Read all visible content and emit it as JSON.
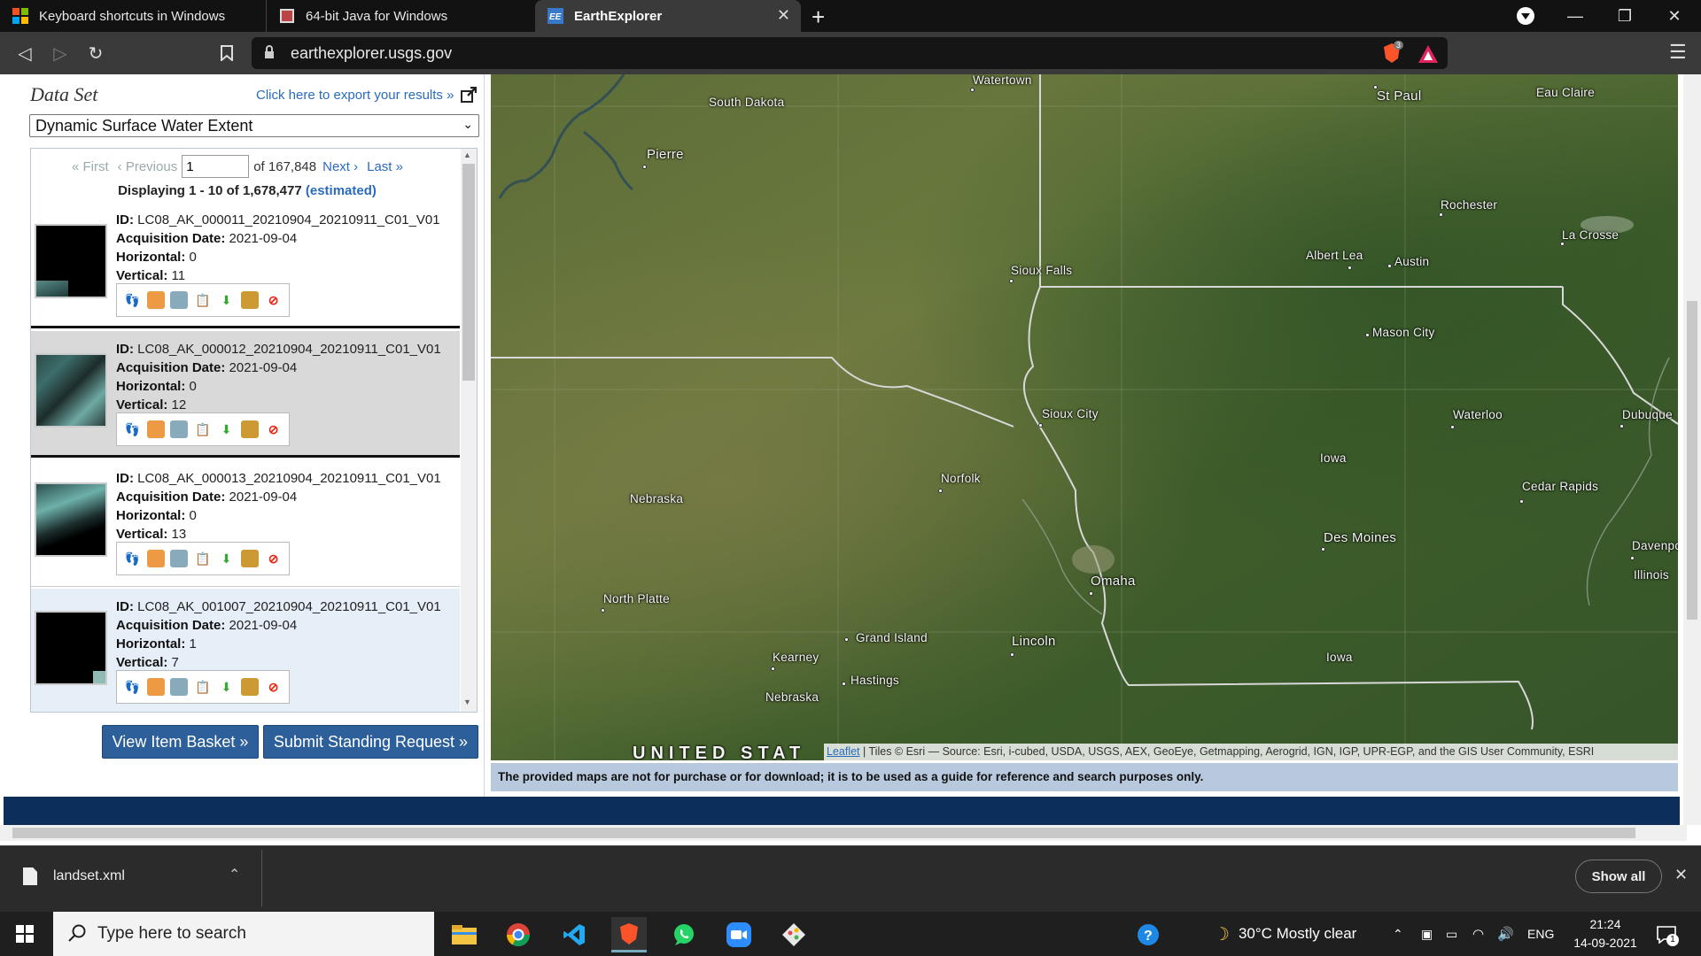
{
  "browser": {
    "tabs": [
      {
        "title": "Keyboard shortcuts in Windows",
        "active": false
      },
      {
        "title": "64-bit Java for Windows",
        "active": false
      },
      {
        "title": "EarthExplorer",
        "active": true
      }
    ],
    "url": "earthexplorer.usgs.gov",
    "shield_count": "3"
  },
  "sidebar": {
    "dataset_heading": "Data Set",
    "export_link": "Click here to export your results »",
    "dataset_selected": "Dynamic Surface Water Extent",
    "pager": {
      "first": "« First",
      "previous": "‹ Previous",
      "page_value": "1",
      "of_pages": "of 167,848",
      "next": "Next ›",
      "last": "Last »"
    },
    "displaying": "Displaying 1 - 10 of 1,678,477",
    "estimated": "(estimated)",
    "labels": {
      "id": "ID:",
      "acq": "Acquisition Date:",
      "horiz": "Horizontal:",
      "vert": "Vertical:"
    },
    "results": [
      {
        "id": "LC08_AK_000011_20210904_20210911_C01_V01",
        "acq_date": "2021-09-04",
        "horizontal": "0",
        "vertical": "11"
      },
      {
        "id": "LC08_AK_000012_20210904_20210911_C01_V01",
        "acq_date": "2021-09-04",
        "horizontal": "0",
        "vertical": "12"
      },
      {
        "id": "LC08_AK_000013_20210904_20210911_C01_V01",
        "acq_date": "2021-09-04",
        "horizontal": "0",
        "vertical": "13"
      },
      {
        "id": "LC08_AK_001007_20210904_20210911_C01_V01",
        "acq_date": "2021-09-04",
        "horizontal": "1",
        "vertical": "7"
      }
    ],
    "view_basket": "View Item Basket »",
    "standing_request": "Submit Standing Request »"
  },
  "map": {
    "labels": {
      "south_dakota": "South Dakota",
      "pierre": "Pierre",
      "watertown": "Watertown",
      "st_paul": "St Paul",
      "eau_claire": "Eau Claire",
      "rochester": "Rochester",
      "la_crosse": "La Crosse",
      "albert_lea": "Albert Lea",
      "austin": "Austin",
      "sioux_falls": "Sioux Falls",
      "mason_city": "Mason City",
      "sioux_city": "Sioux City",
      "waterloo": "Waterloo",
      "dubuque": "Dubuque",
      "iowa1": "Iowa",
      "norfolk": "Norfolk",
      "nebraska1": "Nebraska",
      "cedar_rapids": "Cedar Rapids",
      "des_moines": "Des Moines",
      "davenport": "Davenpo",
      "illinois": "Illinois",
      "omaha": "Omaha",
      "north_platte": "North Platte",
      "grand_island": "Grand Island",
      "lincoln": "Lincoln",
      "kearney": "Kearney",
      "hastings": "Hastings",
      "iowa2": "Iowa",
      "nebraska2": "Nebraska",
      "us": "UNITED STAT"
    },
    "attribution_link": "Leaflet",
    "attribution": "| Tiles © Esri — Source: Esri, i-cubed, USDA, USGS, AEX, GeoEye, Getmapping, Aerogrid, IGN, IGP, UPR-EGP, and the GIS User Community, ESRI",
    "disclaimer": "The provided maps are not for purchase or for download; it is to be used as a guide for reference and search purposes only."
  },
  "downloads": {
    "file": "landset.xml",
    "show_all": "Show all"
  },
  "taskbar": {
    "search_placeholder": "Type here to search",
    "weather": "30°C  Mostly clear",
    "lang": "ENG",
    "time": "21:24",
    "date": "14-09-2021",
    "notif_count": "1"
  },
  "colors": {
    "accent": "#2a6bbd",
    "button": "#2d5f9a",
    "footer": "#0c2e5a"
  }
}
